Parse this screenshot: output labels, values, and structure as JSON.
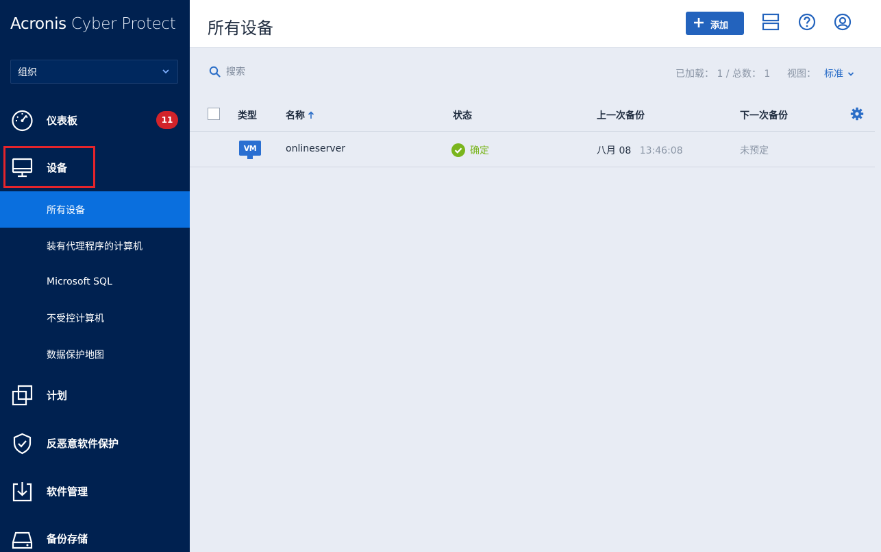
{
  "app": {
    "brand_bold": "Acronis",
    "brand_light": " Cyber Protect"
  },
  "sidebar": {
    "org_select": "组织",
    "items": [
      {
        "label": "仪表板",
        "badge": "11",
        "icon": "dashboard-gauge-icon"
      },
      {
        "label": "设备",
        "icon": "monitor-icon"
      },
      {
        "label": "计划",
        "icon": "plans-icon"
      },
      {
        "label": "反恶意软件保护",
        "icon": "shield-icon"
      },
      {
        "label": "软件管理",
        "icon": "download-box-icon"
      },
      {
        "label": "备份存储",
        "icon": "storage-icon"
      }
    ],
    "sub_items": [
      {
        "label": "所有设备",
        "active": true
      },
      {
        "label": "装有代理程序的计算机"
      },
      {
        "label": "Microsoft SQL"
      },
      {
        "label": "不受控计算机"
      },
      {
        "label": "数据保护地图"
      }
    ]
  },
  "header": {
    "title": "所有设备",
    "add_label": "添加",
    "icons": [
      "layout-icon",
      "help-icon",
      "user-icon"
    ]
  },
  "toolbar": {
    "search_placeholder": "搜索",
    "loaded_info": "已加载： 1 / 总数： 1",
    "view_label": "视图：",
    "view_value": "标准"
  },
  "table": {
    "headers": {
      "type": "类型",
      "name": "名称",
      "status": "状态",
      "last_backup": "上一次备份",
      "next_backup": "下一次备份"
    },
    "rows": [
      {
        "type": "VM",
        "name": "onlineserver",
        "status": "确定",
        "last_backup_date": "八月 08",
        "last_backup_time": "13:46:08",
        "next_backup": "未预定"
      }
    ]
  },
  "colors": {
    "sidebar_bg": "#002150",
    "active_item": "#0a6fde",
    "accent": "#2363bd",
    "badge": "#d2232a",
    "status_ok": "#7ab51d",
    "highlight": "#e5242b"
  }
}
